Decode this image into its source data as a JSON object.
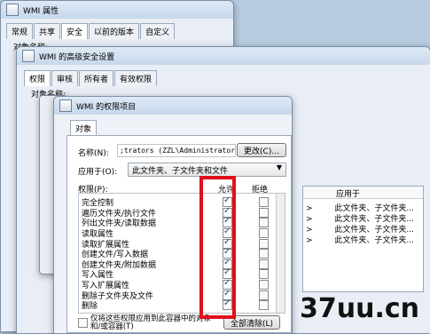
{
  "windows": {
    "props": {
      "title": "WMI 属性",
      "tabs": [
        "常规",
        "共享",
        "安全",
        "以前的版本",
        "自定义"
      ],
      "field_label": "对象名称:"
    },
    "advanced": {
      "title": "WMI 的高级安全设置",
      "tabs": [
        "权限",
        "审核",
        "所有者",
        "有效权限"
      ],
      "field_label": "对象名称:",
      "right_header": "应用于",
      "right_rows": [
        "此文件夹、子文件夹...",
        "此文件夹、子文件夹...",
        "此文件夹、子文件夹...",
        "此文件夹、子文件夹..."
      ]
    },
    "entry": {
      "title": "WMI 的权限项目",
      "tab": "对象",
      "name_label": "名称(N):",
      "name_value": ";trators (ZZL\\Administrators)",
      "change_button": "更改(C)...",
      "apply_label": "应用于(O):",
      "apply_value": "此文件夹、子文件夹和文件",
      "perm_label": "权限(P):",
      "col_allow": "允许",
      "col_deny": "拒绝",
      "permissions": [
        {
          "name": "完全控制",
          "allow": true,
          "deny": false
        },
        {
          "name": "遍历文件夹/执行文件",
          "allow": true,
          "deny": false
        },
        {
          "name": "列出文件夹/读取数据",
          "allow": true,
          "deny": false
        },
        {
          "name": "读取属性",
          "allow": true,
          "deny": false
        },
        {
          "name": "读取扩展属性",
          "allow": true,
          "deny": false
        },
        {
          "name": "创建文件/写入数据",
          "allow": true,
          "deny": false
        },
        {
          "name": "创建文件夹/附加数据",
          "allow": true,
          "deny": false
        },
        {
          "name": "写入属性",
          "allow": true,
          "deny": false
        },
        {
          "name": "写入扩展属性",
          "allow": true,
          "deny": false
        },
        {
          "name": "删除子文件夹及文件",
          "allow": true,
          "deny": false
        },
        {
          "name": "删除",
          "allow": true,
          "deny": false
        }
      ],
      "bottom_checkbox": "仅将这些权限应用到此容器中的对象和/或容器(T)",
      "clear_all_button": "全部清除(L)"
    }
  },
  "watermark": "37uu.cn",
  "colors": {
    "highlight": "#e0101a"
  }
}
